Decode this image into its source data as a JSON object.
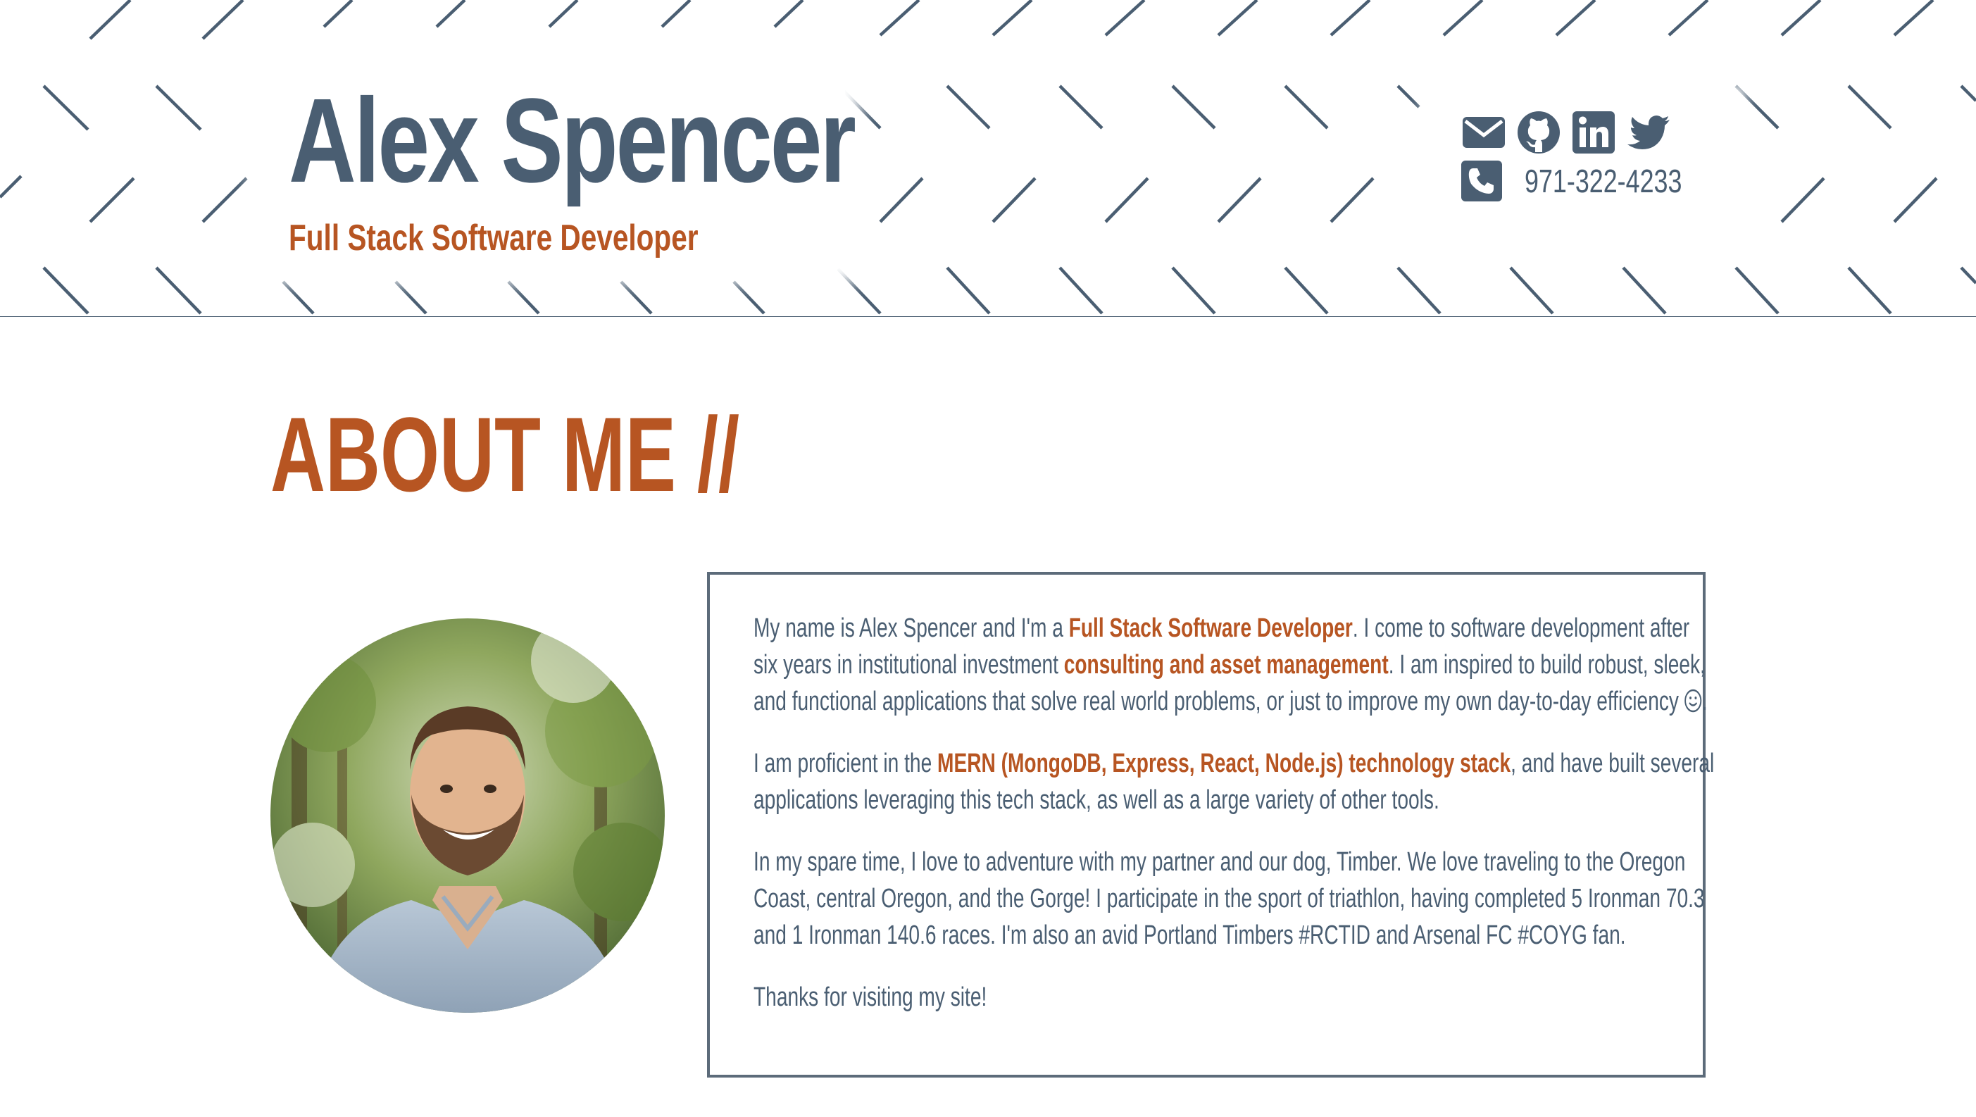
{
  "header": {
    "name": "Alex Spencer",
    "subtitle": "Full Stack Software Developer",
    "phone": "971-322-4233",
    "social_icons": [
      "envelope-icon",
      "github-icon",
      "linkedin-icon",
      "twitter-icon"
    ],
    "phone_icon": "phone-icon"
  },
  "about": {
    "title": "ABOUT ME //",
    "p1": {
      "t1": "My name is Alex Spencer and I'm a ",
      "h1": "Full Stack Software Developer",
      "t2": ". I come to software development after six years in institutional investment ",
      "h2": "consulting and asset management",
      "t3": ". I am inspired to build robust, sleek, and functional applications that solve real world problems, or just to improve my own day-to-day efficiency ",
      "t4": "."
    },
    "p2": {
      "t1": "I am proficient in the ",
      "h1": "MERN (MongoDB, Express, React, Node.js) technology stack",
      "t2": ", and have built several applications leveraging this tech stack, as well as a large variety of other tools."
    },
    "p3": "In my spare time, I love to adventure with my partner and our dog, Timber. We love traveling to the Oregon Coast, central Oregon, and the Gorge! I participate in the sport of triathlon, having completed 5 Ironman 70.3 and 1 Ironman 140.6 races. I'm also an avid Portland Timbers #RCTID and Arsenal FC #COYG fan.",
    "p4": "Thanks for visiting my site!",
    "smiley_icon": "smiley-icon"
  },
  "colors": {
    "primary": "#4a5e72",
    "accent": "#b75522",
    "background": "#ffffff"
  }
}
